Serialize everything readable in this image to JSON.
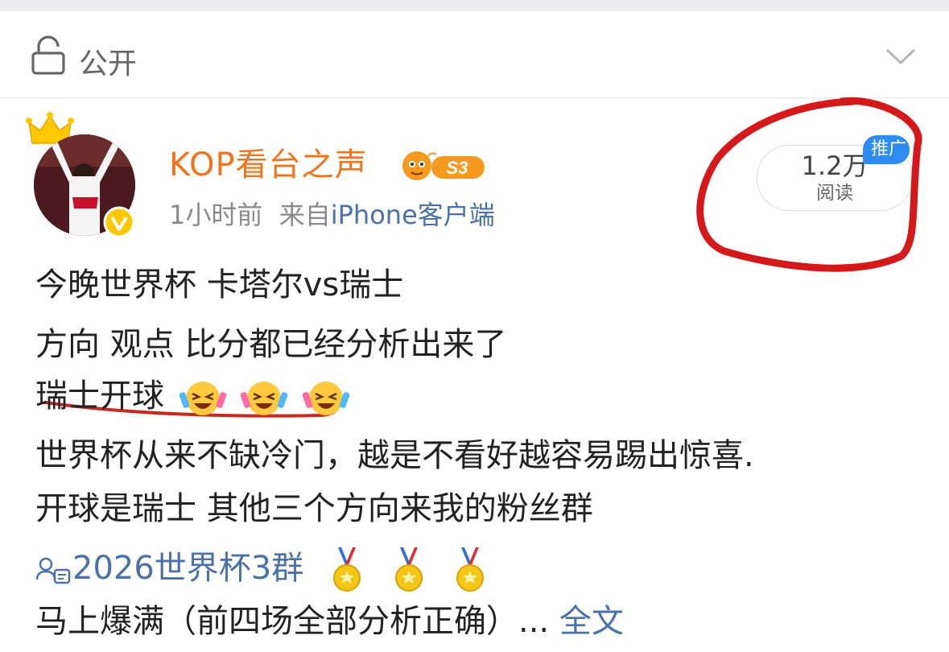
{
  "privacy": {
    "label": "公开"
  },
  "post": {
    "username": "KOP看台之声",
    "level_badge": "S3",
    "time": "1小时前",
    "source_prefix": "来自",
    "source": "iPhone客户端",
    "reads": {
      "count": "1.2万",
      "label": "阅读"
    },
    "ad_badge": "推广",
    "lines": [
      "今晚世界杯 卡塔尔vs瑞士",
      "方向 观点 比分都已经分析出来了",
      "瑞士开球",
      "世界杯从来不缺冷门，越是不看好越容易踢出惊喜.",
      "开球是瑞士 其他三个方向来我的粉丝群"
    ],
    "group_link": "2026世界杯3群",
    "last_line": "马上爆满（前四场全部分析正确）...",
    "full_text_link": "全文"
  },
  "icons": {
    "lock": "lock-icon",
    "chevron": "chevron-down-icon",
    "crown": "crown-icon",
    "verified": "verified-badge-icon",
    "emoji": "laughing-crying-emoji",
    "medal": "gold-medal-icon",
    "group": "group-chat-icon"
  },
  "colors": {
    "username": "#f1731c",
    "link": "#4a72a8",
    "ad_badge": "#2e8cf0",
    "annotation": "#d5181a"
  }
}
